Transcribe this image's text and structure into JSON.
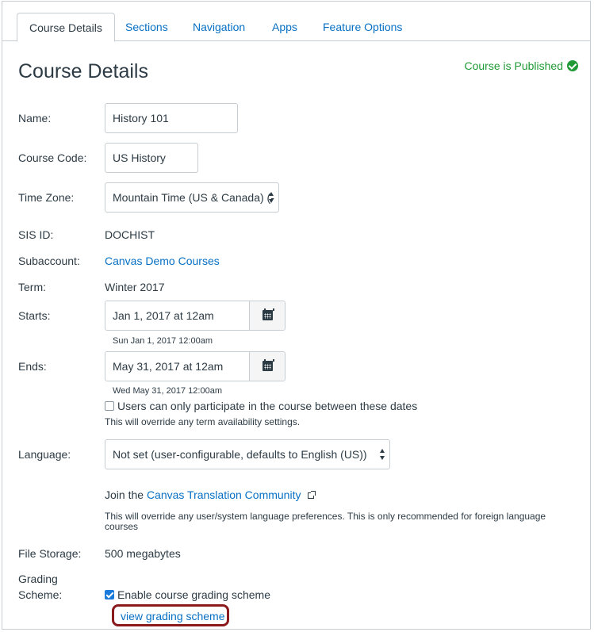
{
  "tabs": [
    {
      "label": "Course Details"
    },
    {
      "label": "Sections"
    },
    {
      "label": "Navigation"
    },
    {
      "label": "Apps"
    },
    {
      "label": "Feature Options"
    }
  ],
  "page": {
    "title": "Course Details",
    "status": "Course is Published"
  },
  "form": {
    "name_label": "Name:",
    "name_value": "History 101",
    "code_label": "Course Code:",
    "code_value": "US History",
    "timezone_label": "Time Zone:",
    "timezone_value": "Mountain Time (US & Canada) (-",
    "sis_label": "SIS ID:",
    "sis_value": "DOCHIST",
    "subaccount_label": "Subaccount:",
    "subaccount_value": "Canvas Demo Courses",
    "term_label": "Term:",
    "term_value": "Winter 2017",
    "starts_label": "Starts:",
    "starts_value": "Jan 1, 2017 at 12am",
    "starts_hint": "Sun Jan 1, 2017 12:00am",
    "ends_label": "Ends:",
    "ends_value": "May 31, 2017 at 12am",
    "ends_hint": "Wed May 31, 2017 12:00am",
    "restrict_label": "Users can only participate in the course between these dates",
    "restrict_note": "This will override any term availability settings.",
    "language_label": "Language:",
    "language_value": "Not set (user-configurable, defaults to English (US))",
    "join_prefix": "Join the",
    "join_link": "Canvas Translation Community",
    "language_note_1": "This will override any user/system language preferences. This is only recommended for foreign language",
    "language_note_2": "courses",
    "storage_label": "File Storage:",
    "storage_value": "500 megabytes",
    "grading_label_1": "Grading",
    "grading_label_2": "Scheme:",
    "grading_checkbox_label": "Enable course grading scheme",
    "grading_link": "view grading scheme"
  },
  "colors": {
    "link": "#0770c4",
    "published": "#1f9a36",
    "highlight": "#8b1a1d",
    "text": "#2d3b45"
  },
  "icons": [
    "check-circle-icon",
    "calendar-icon",
    "select-arrows-icon",
    "external-link-icon"
  ]
}
